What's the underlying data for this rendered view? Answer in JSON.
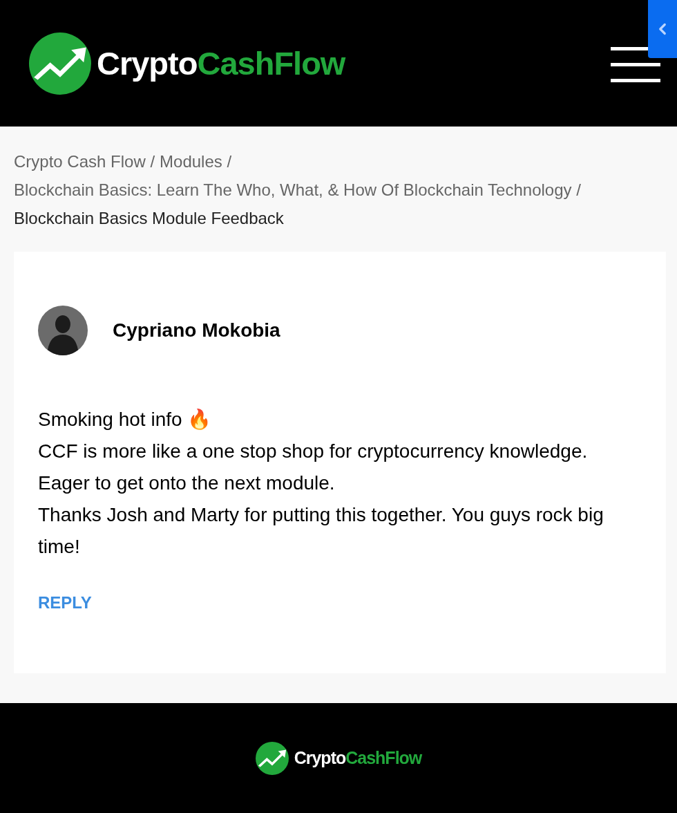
{
  "header": {
    "logo": {
      "parts": [
        {
          "text": "Crypto",
          "kind": "plain"
        },
        {
          "text": "CashFlow",
          "kind": "accent"
        }
      ]
    }
  },
  "breadcrumb": [
    {
      "label": "Crypto Cash Flow",
      "separator": "/",
      "current": false
    },
    {
      "label": "Modules",
      "separator": "/",
      "current": false
    },
    {
      "label": "Blockchain Basics: Learn The Who, What, & How Of Blockchain Technology",
      "separator": "/",
      "current": false
    },
    {
      "label": "Blockchain Basics Module Feedback",
      "current": true
    }
  ],
  "comment": {
    "author": "Cypriano Mokobia",
    "lines": [
      "Smoking hot info 🔥",
      "CCF is more like a one stop shop for cryptocurrency knowledge.",
      "Eager to get onto the next module.",
      "Thanks Josh and Marty for putting this together. You guys rock big time!"
    ],
    "reply": "REPLY"
  },
  "footer": {
    "logo": {
      "parts": [
        {
          "text": "Crypto",
          "kind": "plain"
        },
        {
          "text": "CashFlow",
          "kind": "accent"
        }
      ]
    }
  }
}
